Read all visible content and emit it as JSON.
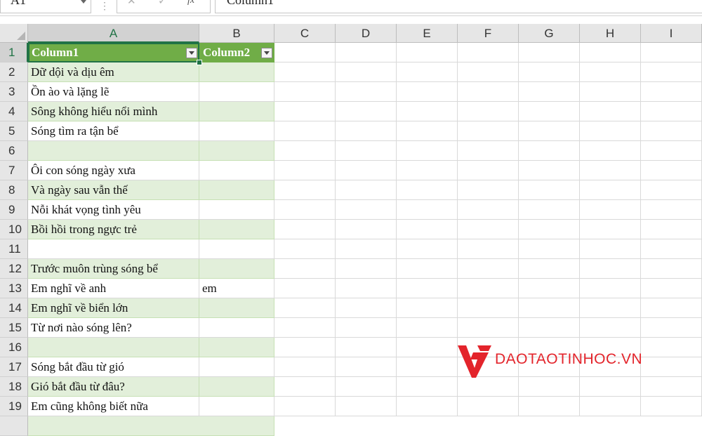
{
  "formula_bar": {
    "name_box": "A1",
    "cancel_icon": "✕",
    "enter_icon": "✓",
    "fx_label": "fx",
    "content": "Column1"
  },
  "columns": [
    "A",
    "B",
    "C",
    "D",
    "E",
    "F",
    "G",
    "H",
    "I"
  ],
  "rows": [
    {
      "num": "1",
      "a": "Column1",
      "b": "Column2"
    },
    {
      "num": "2",
      "a": "Dữ dội và dịu êm",
      "b": ""
    },
    {
      "num": "3",
      "a": "Ồn ào và lặng lẽ",
      "b": ""
    },
    {
      "num": "4",
      "a": "Sông không hiểu nổi mình",
      "b": ""
    },
    {
      "num": "5",
      "a": "Sóng tìm ra tận bể",
      "b": ""
    },
    {
      "num": "6",
      "a": "",
      "b": ""
    },
    {
      "num": "7",
      "a": "Ôi con sóng ngày xưa",
      "b": ""
    },
    {
      "num": "8",
      "a": "Và ngày sau vẫn thế",
      "b": ""
    },
    {
      "num": "9",
      "a": "Nỗi khát vọng tình yêu",
      "b": ""
    },
    {
      "num": "10",
      "a": "Bồi hồi trong ngực trẻ",
      "b": ""
    },
    {
      "num": "11",
      "a": "",
      "b": ""
    },
    {
      "num": "12",
      "a": "Trước muôn trùng sóng bể",
      "b": ""
    },
    {
      "num": "13",
      "a": "Em nghĩ về anh",
      "b": "em"
    },
    {
      "num": "14",
      "a": "Em nghĩ về biển lớn",
      "b": ""
    },
    {
      "num": "15",
      "a": "Từ nơi nào sóng lên?",
      "b": ""
    },
    {
      "num": "16",
      "a": "",
      "b": ""
    },
    {
      "num": "17",
      "a": "Sóng bắt đầu từ gió",
      "b": ""
    },
    {
      "num": "18",
      "a": "Gió bắt đầu từ đâu?",
      "b": ""
    },
    {
      "num": "19",
      "a": "Em cũng không biết nữa",
      "b": ""
    }
  ],
  "watermark": {
    "text": "DAOTAOTINHOC.VN",
    "color": "#e3242b"
  },
  "colors": {
    "header_fill": "#70ad47",
    "band_fill": "#e2efda",
    "selection": "#217346"
  }
}
